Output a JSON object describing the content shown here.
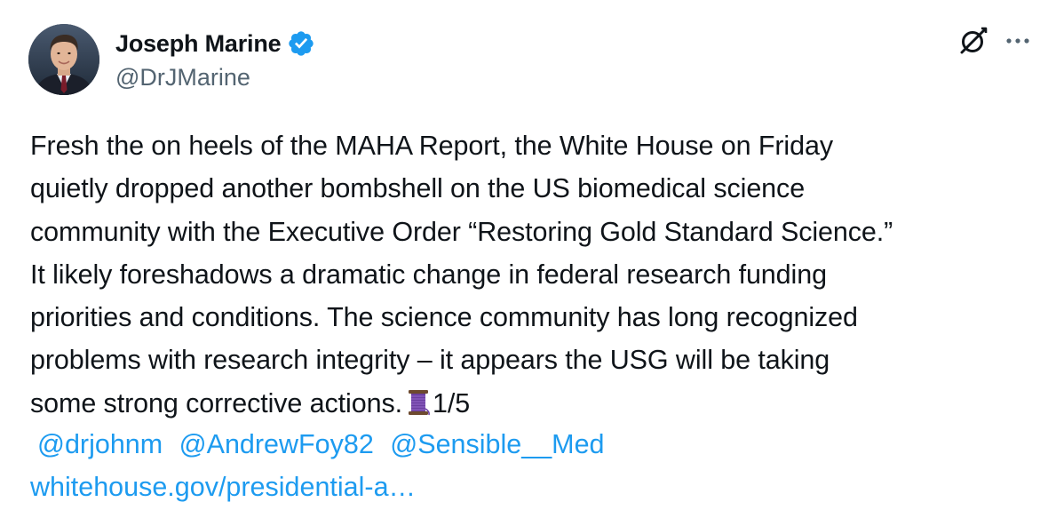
{
  "author": {
    "display_name": "Joseph Marine",
    "handle": "@DrJMarine",
    "verified": true,
    "avatar_icon": "profile-photo"
  },
  "actions": {
    "grok_icon": "grok-icon",
    "more_icon": "more-dots-icon"
  },
  "tweet": {
    "lines": [
      "Fresh the on heels of the MAHA Report, the White House on Friday",
      "quietly dropped another bombshell on the US biomedical science",
      "community with the Executive Order “Restoring Gold Standard Science.”",
      "It likely foreshadows a dramatic change in federal research funding",
      "priorities and conditions. The science community has long recognized",
      "problems with research integrity – it appears the USG will be taking",
      "some strong corrective actions."
    ],
    "thread_emoji": "spool-of-thread-icon",
    "thread_count": "1/5",
    "mentions": [
      "@drjohnm",
      "@AndrewFoy82",
      "@Sensible__Med"
    ],
    "link": "whitehouse.gov/presidential-a…"
  },
  "colors": {
    "text": "#0f1419",
    "secondary": "#536471",
    "link": "#1d9bf0",
    "verified": "#1d9bf0"
  }
}
